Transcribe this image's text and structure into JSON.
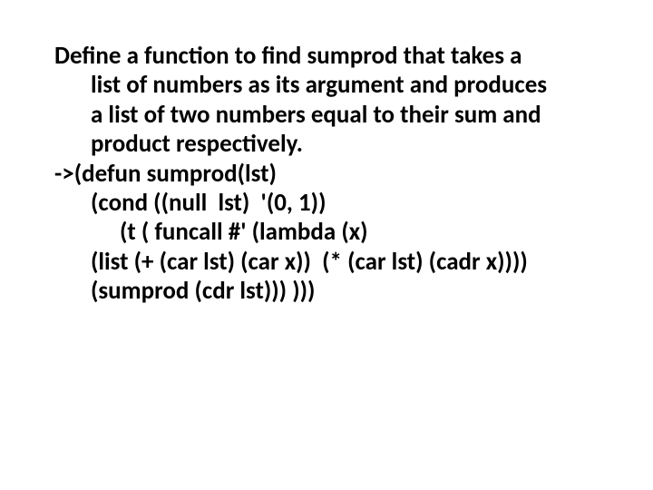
{
  "slide": {
    "lines": {
      "l0": "Define a function to find sumprod that takes a",
      "l1": "list of numbers as its argument and produces",
      "l2": "a list of two numbers equal to their sum and",
      "l3": "product respectively.",
      "l4": "->(defun sumprod(lst)",
      "l5": "(cond ((null  lst)  '(0, 1))",
      "l6": "(t ( funcall #' (lambda (x)",
      "l7": "(list (+ (car lst) (car x))  (* (car lst) (cadr x))))",
      "l8": "(sumprod (cdr lst))) )))"
    }
  }
}
